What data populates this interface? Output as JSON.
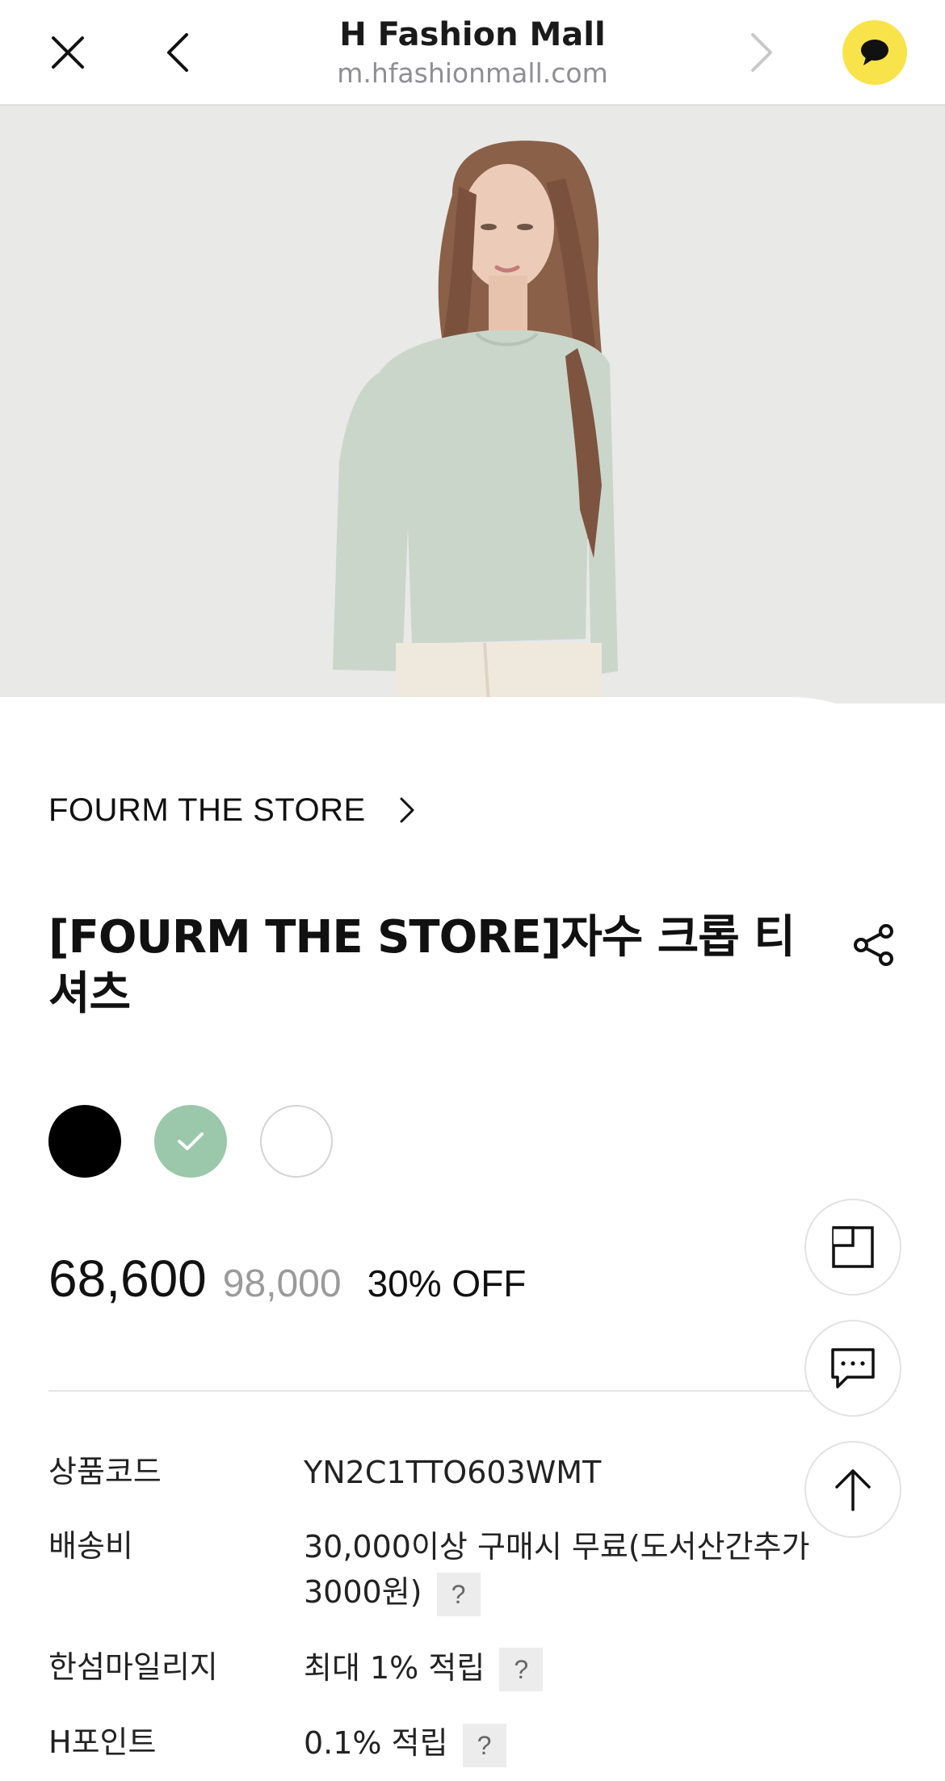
{
  "header": {
    "site_title": "H Fashion Mall",
    "site_url": "m.hfashionmall.com",
    "icons": {
      "close": "close-icon",
      "back": "chevron-left-icon",
      "forward": "chevron-right-icon",
      "chat": "speech-bubble-icon"
    },
    "chat_color": "#f8e34a"
  },
  "product": {
    "brand": "FOURM THE STORE",
    "title": "[FOURM THE STORE]자수 크롭 티셔츠",
    "colors": [
      {
        "name": "black",
        "hex": "#000000",
        "selected": false
      },
      {
        "name": "mint",
        "hex": "#9bc7ab",
        "selected": true
      },
      {
        "name": "white",
        "hex": "#ffffff",
        "selected": false
      }
    ],
    "price": {
      "sale": "68,600",
      "original": "98,000",
      "discount": "30% OFF"
    },
    "details": [
      {
        "label": "상품코드",
        "value": "YN2C1TTO603WMT",
        "help": false
      },
      {
        "label": "배송비",
        "value": "30,000이상 구매시 무료(도서산간추가 3000원)",
        "help": true
      },
      {
        "label": "한섬마일리지",
        "value": "최대 1% 적립",
        "help": true
      },
      {
        "label": "H포인트",
        "value": "0.1% 적립",
        "help": true
      }
    ],
    "help_mark": "?"
  },
  "floating": {
    "icons": [
      "recent-view-icon",
      "chat-dots-icon",
      "arrow-up-icon"
    ]
  }
}
